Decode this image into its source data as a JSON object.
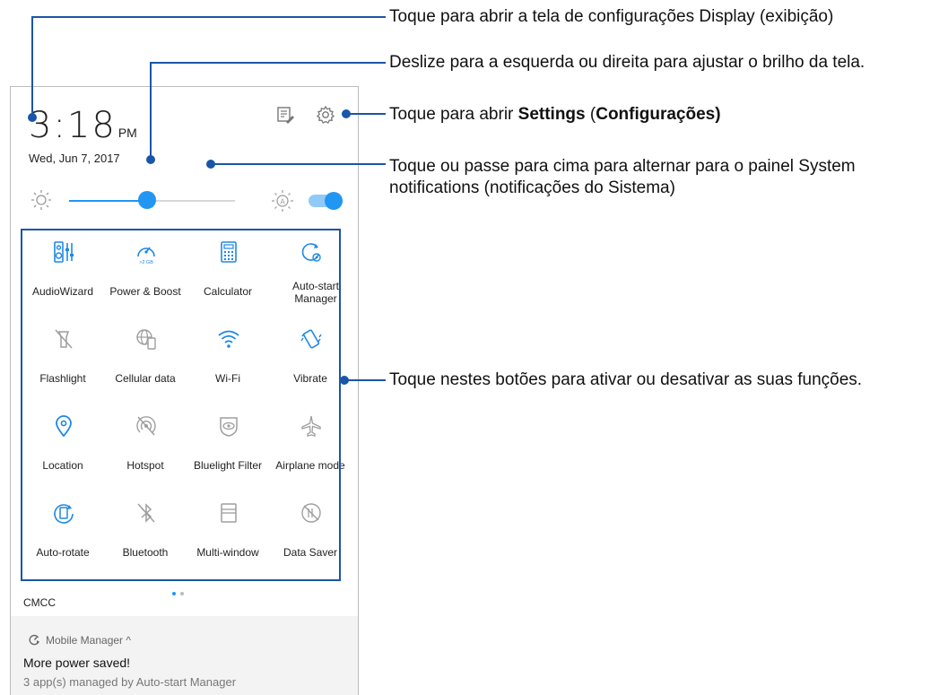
{
  "status": {
    "time": "3:18",
    "ampm": "PM",
    "date": "Wed, Jun 7, 2017"
  },
  "brightness": {
    "level": 0.47,
    "auto": true
  },
  "tiles": [
    {
      "label": "AudioWizard",
      "icon": "audiowizard-icon",
      "active": true
    },
    {
      "label": "Power & Boost",
      "icon": "power-boost-icon",
      "active": true,
      "sub": ">2 GB"
    },
    {
      "label": "Calculator",
      "icon": "calculator-icon",
      "active": true
    },
    {
      "label": "Auto-start Manager",
      "icon": "autostart-manager-icon",
      "active": true
    },
    {
      "label": "Flashlight",
      "icon": "flashlight-icon",
      "active": false
    },
    {
      "label": "Cellular data",
      "icon": "cellular-data-icon",
      "active": false
    },
    {
      "label": "Wi-Fi",
      "icon": "wifi-icon",
      "active": true
    },
    {
      "label": "Vibrate",
      "icon": "vibrate-icon",
      "active": true
    },
    {
      "label": "Location",
      "icon": "location-icon",
      "active": true
    },
    {
      "label": "Hotspot",
      "icon": "hotspot-icon",
      "active": false
    },
    {
      "label": "Bluelight Filter",
      "icon": "bluelight-filter-icon",
      "active": false
    },
    {
      "label": "Airplane mode",
      "icon": "airplane-icon",
      "active": false
    },
    {
      "label": "Auto-rotate",
      "icon": "auto-rotate-icon",
      "active": true
    },
    {
      "label": "Bluetooth",
      "icon": "bluetooth-icon",
      "active": false
    },
    {
      "label": "Multi-window",
      "icon": "multi-window-icon",
      "active": false
    },
    {
      "label": "Data Saver",
      "icon": "data-saver-icon",
      "active": false
    }
  ],
  "carrier": "CMCC",
  "notification": {
    "app": "Mobile Manager ^",
    "title": "More power saved!",
    "text": "3 app(s) managed by Auto-start Manager"
  },
  "annotations": {
    "display": "Toque para abrir a tela de configurações Display (exibição)",
    "brightness": "Deslize para a esquerda ou direita para ajustar o brilho da tela.",
    "settings_pre": "Toque para abrir ",
    "settings_b1": "Settings",
    "settings_mid": " (",
    "settings_b2": "Configurações)",
    "notifications_1": "Toque ou passe para cima para alternar para o painel System",
    "notifications_2": "notifications (notificações do Sistema)",
    "buttons": "Toque nestes botões para ativar ou desativar as suas funções."
  },
  "colors": {
    "accent": "#2196f3",
    "active_icon": "#1e88e5",
    "inactive_icon": "#9e9e9e",
    "callout": "#1a56a8"
  }
}
